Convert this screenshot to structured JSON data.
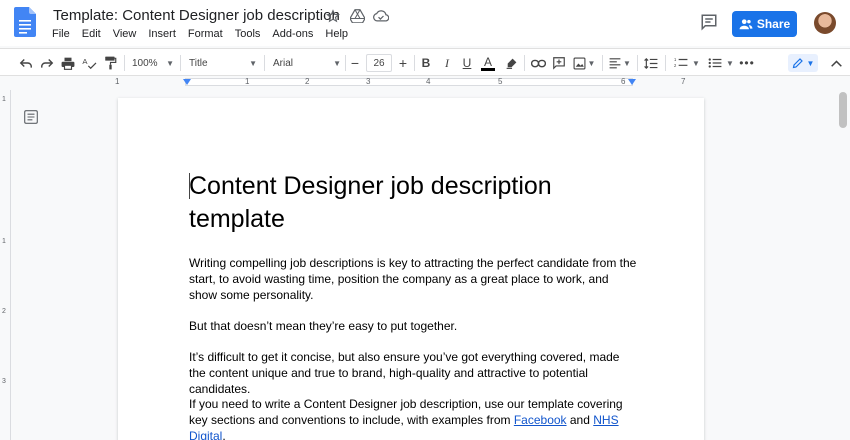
{
  "header": {
    "title": "Template: Content Designer job description",
    "menu": [
      "File",
      "Edit",
      "View",
      "Insert",
      "Format",
      "Tools",
      "Add-ons",
      "Help"
    ],
    "share_label": "Share"
  },
  "toolbar": {
    "zoom": "100%",
    "style": "Title",
    "font": "Arial",
    "font_size": "26"
  },
  "ruler": {
    "numbers": [
      "1",
      "1",
      "2",
      "3",
      "4",
      "5",
      "6",
      "7"
    ]
  },
  "vruler": {
    "numbers": [
      "1",
      "1",
      "2",
      "3"
    ]
  },
  "document": {
    "heading": "Content Designer job description template",
    "paragraphs": [
      "Writing compelling job descriptions is key to attracting the perfect candidate from the start, to avoid wasting time, position the company as a great place to work, and show some personality.",
      "But that doesn’t mean they’re easy to put together.",
      "It’s difficult to get it concise, but also ensure you’ve got everything covered, made the content unique and true to brand, high-quality and attractive to potential candidates."
    ],
    "last_paragraph": {
      "text_before": "If you need to write a Content Designer job description, use our template covering key sections and conventions to include, with examples from ",
      "link1": "Facebook",
      "and": " and ",
      "link2_part1": "NHS",
      "link2_part2": "Digital",
      "end": "."
    }
  },
  "colors": {
    "accent": "#1a73e8",
    "docs_blue": "#4285f4",
    "link": "#1155cc"
  }
}
